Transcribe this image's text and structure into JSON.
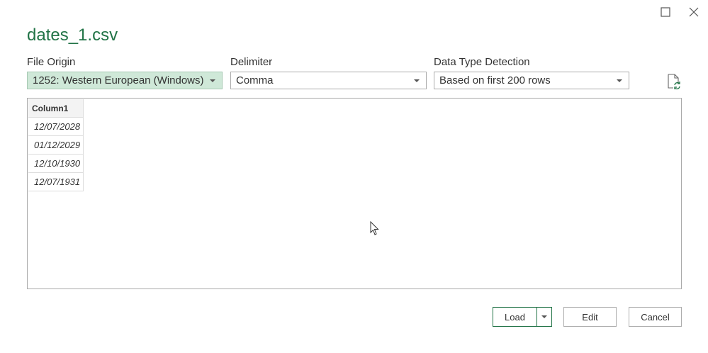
{
  "window": {
    "title": "dates_1.csv"
  },
  "file_origin": {
    "label": "File Origin",
    "value": "1252: Western European (Windows)"
  },
  "delimiter": {
    "label": "Delimiter",
    "value": "Comma"
  },
  "data_type_detection": {
    "label": "Data Type Detection",
    "value": "Based on first 200 rows"
  },
  "preview": {
    "columns": [
      "Column1"
    ],
    "rows": [
      [
        "12/07/2028"
      ],
      [
        "01/12/2029"
      ],
      [
        "12/10/1930"
      ],
      [
        "12/07/1931"
      ]
    ]
  },
  "buttons": {
    "load": "Load",
    "edit": "Edit",
    "cancel": "Cancel"
  },
  "colors": {
    "accent": "#217346",
    "selected_dropdown_bg": "#cfe8d8"
  },
  "icons": {
    "maximize": "maximize-icon",
    "close": "close-icon",
    "refresh": "refresh-file-icon",
    "dropdown": "chevron-down-icon"
  }
}
